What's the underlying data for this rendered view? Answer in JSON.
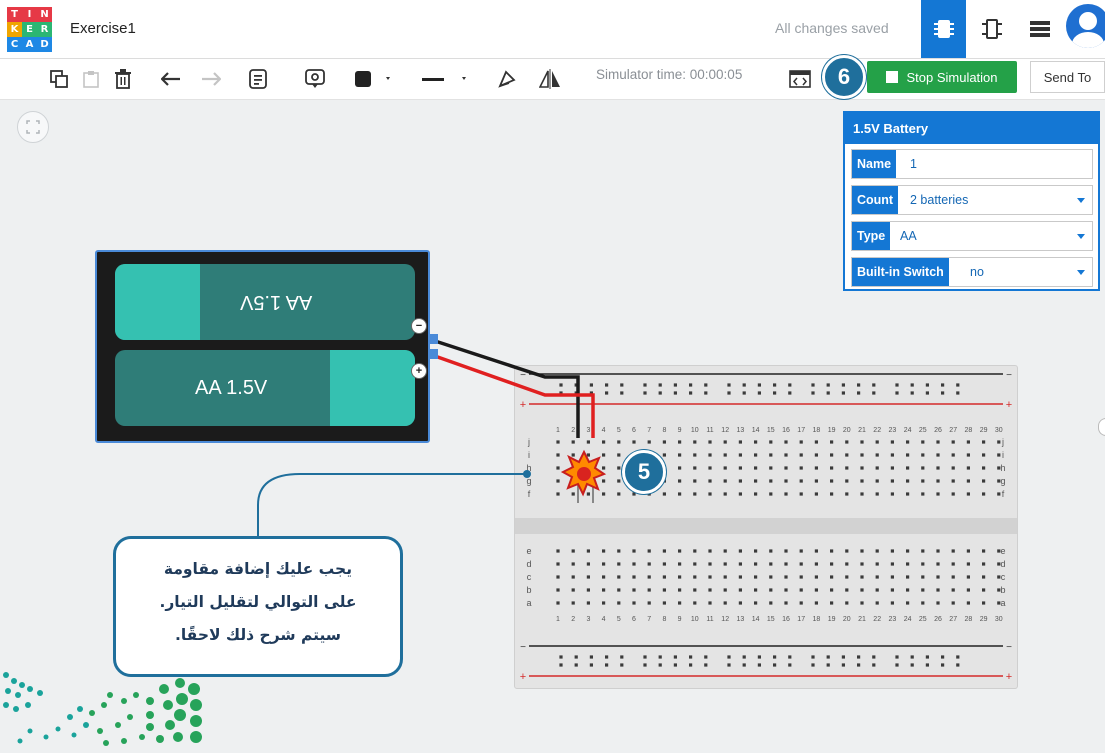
{
  "app": {
    "logo_letters": [
      "T",
      "I",
      "N",
      "K",
      "E",
      "R",
      "C",
      "A",
      "D"
    ],
    "logo_colors": [
      "#e63946",
      "#e63946",
      "#e63946",
      "#f0a500",
      "#2bb673",
      "#2bb673",
      "#1e88e5",
      "#1e88e5",
      "#1e88e5"
    ],
    "title": "Exercise1",
    "status": "All changes saved",
    "view_buttons": [
      "circuit-view-icon",
      "schematic-view-icon",
      "component-list-icon"
    ],
    "accent": "#1477d4"
  },
  "toolbar": {
    "simulator_time": "Simulator time: 00:00:05",
    "stop_label": "Stop Simulation",
    "send_to_label": "Send To",
    "stop_color": "#24a148"
  },
  "badges": {
    "stop": "6",
    "led": "5"
  },
  "inspector": {
    "title": "1.5V Battery",
    "fields": [
      {
        "label": "Name",
        "value": "1"
      },
      {
        "label": "Count",
        "value": "2 batteries"
      },
      {
        "label": "Type",
        "value": "AA"
      },
      {
        "label": "Built-in Switch",
        "value": "no"
      }
    ]
  },
  "battery": {
    "top_label": "AA 1.5V",
    "bottom_label": "AA 1.5V",
    "neg": "−",
    "pos": "+"
  },
  "breadboard": {
    "cols": [
      "1",
      "2",
      "3",
      "4",
      "5",
      "6",
      "7",
      "8",
      "9",
      "10",
      "11",
      "12",
      "13",
      "14",
      "15",
      "16",
      "17",
      "18",
      "19",
      "20",
      "21",
      "22",
      "23",
      "24",
      "25",
      "26",
      "27",
      "28",
      "29",
      "30"
    ],
    "top_rows": [
      "j",
      "i",
      "h",
      "g",
      "f"
    ],
    "bottom_rows": [
      "e",
      "d",
      "c",
      "b",
      "a"
    ],
    "rail_minus": "−",
    "rail_plus": "+"
  },
  "callout": {
    "lines": [
      "يجب عليك إضافة مقاومة",
      "على التوالي لتقليل التيار.",
      "سيتم شرح ذلك لاحقًا."
    ]
  }
}
